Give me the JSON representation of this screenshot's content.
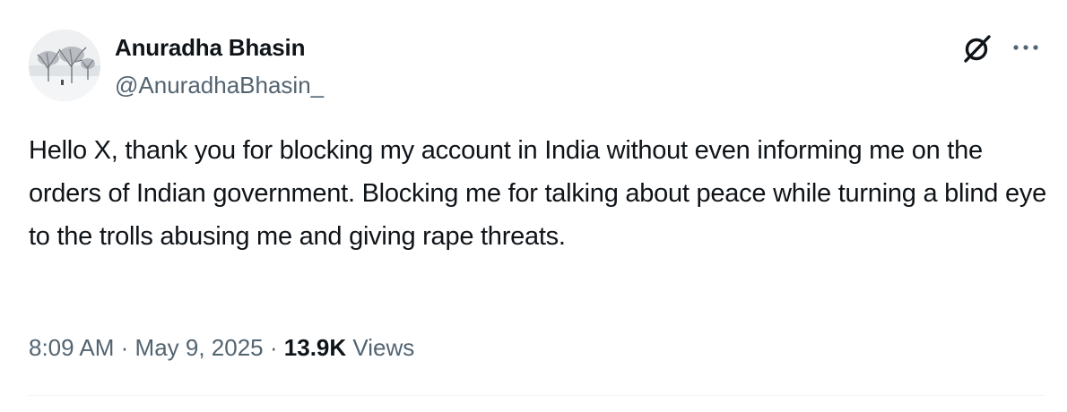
{
  "author": {
    "name": "Anuradha Bhasin",
    "handle": "@AnuradhaBhasin_"
  },
  "icons": {
    "grok": "grok-icon",
    "more": "more-options-icon"
  },
  "tweet": {
    "text": "Hello X, thank you for blocking my account in India without even informing me on the orders of Indian government. Blocking me for talking about peace while turning a blind eye to the trolls abusing me and giving rape threats."
  },
  "meta": {
    "time": "8:09 AM",
    "separator": "·",
    "date": "May 9, 2025",
    "views_count": "13.9K",
    "views_label": "Views"
  },
  "colors": {
    "text_primary": "#0f1419",
    "text_secondary": "#536471",
    "divider": "#eff3f4"
  }
}
